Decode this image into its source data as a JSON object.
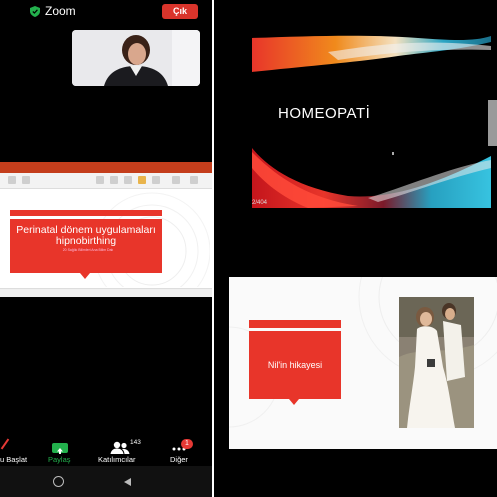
{
  "zoom": {
    "app_title": "Zoom",
    "leave_label": "Çık",
    "toolbar": {
      "start_label": "u Başlat",
      "share_label": "Paylaş",
      "participants_label": "Katılımcılar",
      "participants_count": "143",
      "more_label": "Diğer",
      "more_badge": "1"
    }
  },
  "shared_slides": {
    "left_slide": {
      "title": "Perinatal dönem uygulamaları hipnobirthing",
      "subtitle": "20 Sağlık Bilimleri Ana Bilim Dalı"
    },
    "homeopati": {
      "title": "HOMEOPATİ",
      "slide_number": "2/404"
    },
    "nil": {
      "title": "Nil'in hikayesi"
    }
  },
  "colors": {
    "accent_red": "#e8352a",
    "zoom_green": "#23b14d",
    "leave_red": "#d9342b"
  }
}
